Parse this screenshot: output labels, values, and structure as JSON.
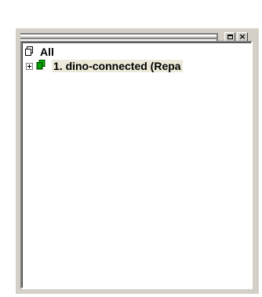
{
  "panel": {
    "restore_icon": "restore-icon",
    "close_icon": "close-icon",
    "close_glyph": "×"
  },
  "tree": {
    "root": {
      "label": "All",
      "icon": "documents-icon"
    },
    "items": [
      {
        "label": "1. dino-connected (Repa",
        "icon": "green-documents-icon",
        "expander": "plus",
        "selected": true,
        "icon_color": "#00a000"
      }
    ]
  },
  "colors": {
    "panel_bg": "#d4d0c8",
    "tree_bg": "#ffffff",
    "selection_bg": "#ece9d8",
    "accent_green": "#00a000"
  }
}
